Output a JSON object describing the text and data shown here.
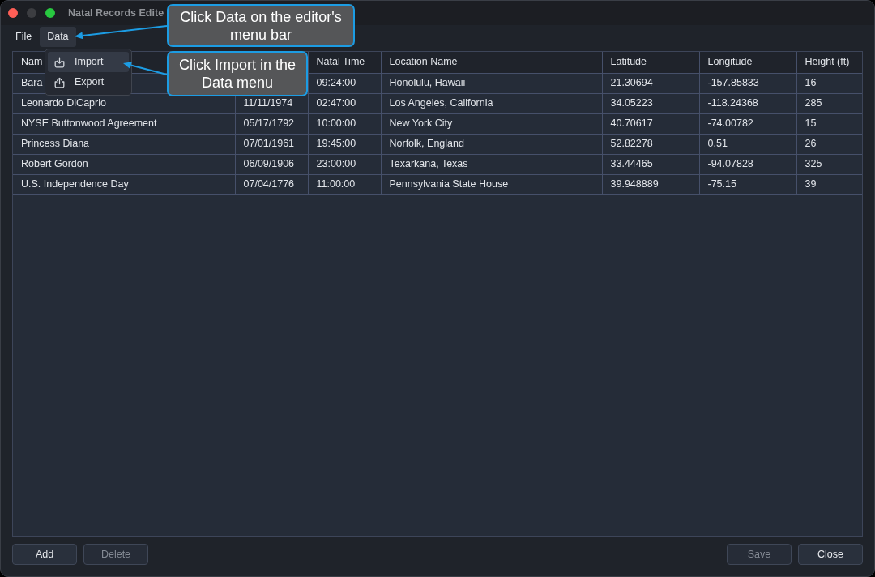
{
  "window": {
    "title": "Natal Records Edite",
    "buttons": [
      {
        "kind": "close",
        "disabled": false
      },
      {
        "kind": "minimize",
        "disabled": true
      },
      {
        "kind": "zoom",
        "disabled": false
      }
    ]
  },
  "menu_bar": [
    {
      "label": "File",
      "selected": false
    },
    {
      "label": "Data",
      "selected": true
    }
  ],
  "data_menu": {
    "items": [
      {
        "kind": "import",
        "label": "Import",
        "selected": true
      },
      {
        "kind": "export",
        "label": "Export",
        "selected": false
      }
    ]
  },
  "table": {
    "columns": [
      "Nam",
      null,
      "Natal Time",
      "Location Name",
      "Latitude",
      "Longitude",
      "Height (ft)"
    ],
    "rows": [
      [
        "Bara",
        null,
        "09:24:00",
        "Honolulu, Hawaii",
        "21.30694",
        "-157.85833",
        "16"
      ],
      [
        "Leonardo DiCaprio",
        "11/11/1974",
        "02:47:00",
        "Los Angeles, California",
        "34.05223",
        "-118.24368",
        "285"
      ],
      [
        "NYSE Buttonwood Agreement",
        "05/17/1792",
        "10:00:00",
        "New York City",
        "40.70617",
        "-74.00782",
        "15"
      ],
      [
        "Princess Diana",
        "07/01/1961",
        "19:45:00",
        "Norfolk, England",
        "52.82278",
        "0.51",
        "26"
      ],
      [
        "Robert Gordon",
        "06/09/1906",
        "23:00:00",
        "Texarkana, Texas",
        "33.44465",
        "-94.07828",
        "325"
      ],
      [
        "U.S. Independence Day",
        "07/04/1776",
        "11:00:00",
        "Pennsylvania State House",
        "39.948889",
        "-75.15",
        "39"
      ]
    ]
  },
  "left_buttons": [
    {
      "label": "Add",
      "disabled": false
    },
    {
      "label": "Delete",
      "disabled": true
    }
  ],
  "right_buttons": [
    {
      "label": "Save",
      "disabled": true
    },
    {
      "label": "Close",
      "disabled": false
    }
  ],
  "callouts": [
    {
      "text": "Click Data on the editor's menu bar"
    },
    {
      "text": "Click Import in the Data menu"
    }
  ]
}
